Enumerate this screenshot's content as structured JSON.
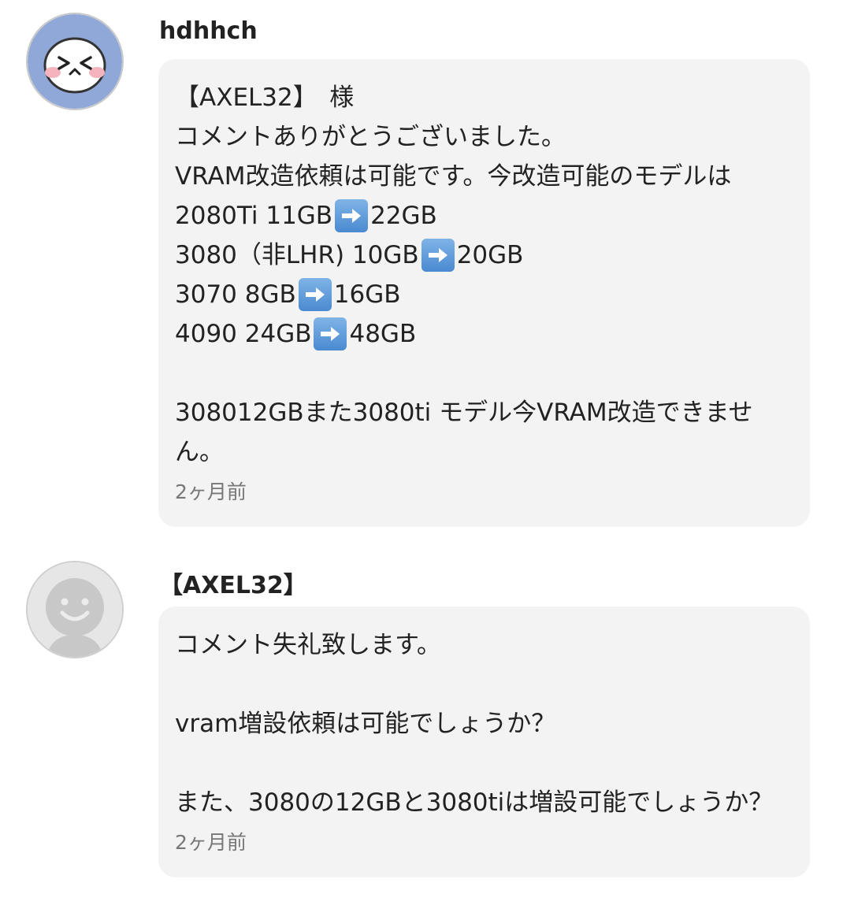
{
  "comments": [
    {
      "username": "hdhhch",
      "avatar": "laughing-face-icon",
      "lines": [
        "【AXEL32】　様",
        "コメントありがとうございました。",
        "VRAM改造依頼は可能です。今改造可能のモデルは",
        {
          "before": "2080Ti 11GB",
          "after": " 22GB"
        },
        {
          "before": "3080（非LHR) 10GB",
          "after": "20GB"
        },
        {
          "before": "3070 8GB",
          "after": " 16GB"
        },
        {
          "before": "4090 24GB",
          "after": " 48GB"
        },
        "",
        "308012GBまた3080ti モデル今VRAM改造できませ",
        "ん。"
      ],
      "timestamp": "2ヶ月前"
    },
    {
      "username": "【AXEL32】",
      "avatar": "default-user-icon",
      "lines": [
        "コメント失礼致します。",
        "",
        "vram増設依頼は可能でしょうか？",
        "",
        "また、3080の12GBと3080tiは増設可能でしょうか？"
      ],
      "timestamp": "2ヶ月前"
    }
  ],
  "colors": {
    "bubble_bg": "#f3f3f3",
    "avatar1_bg": "#8fa8d8",
    "avatar2_bg": "#e6e6e6",
    "arrow_emoji_bg": "#5b97d6"
  }
}
